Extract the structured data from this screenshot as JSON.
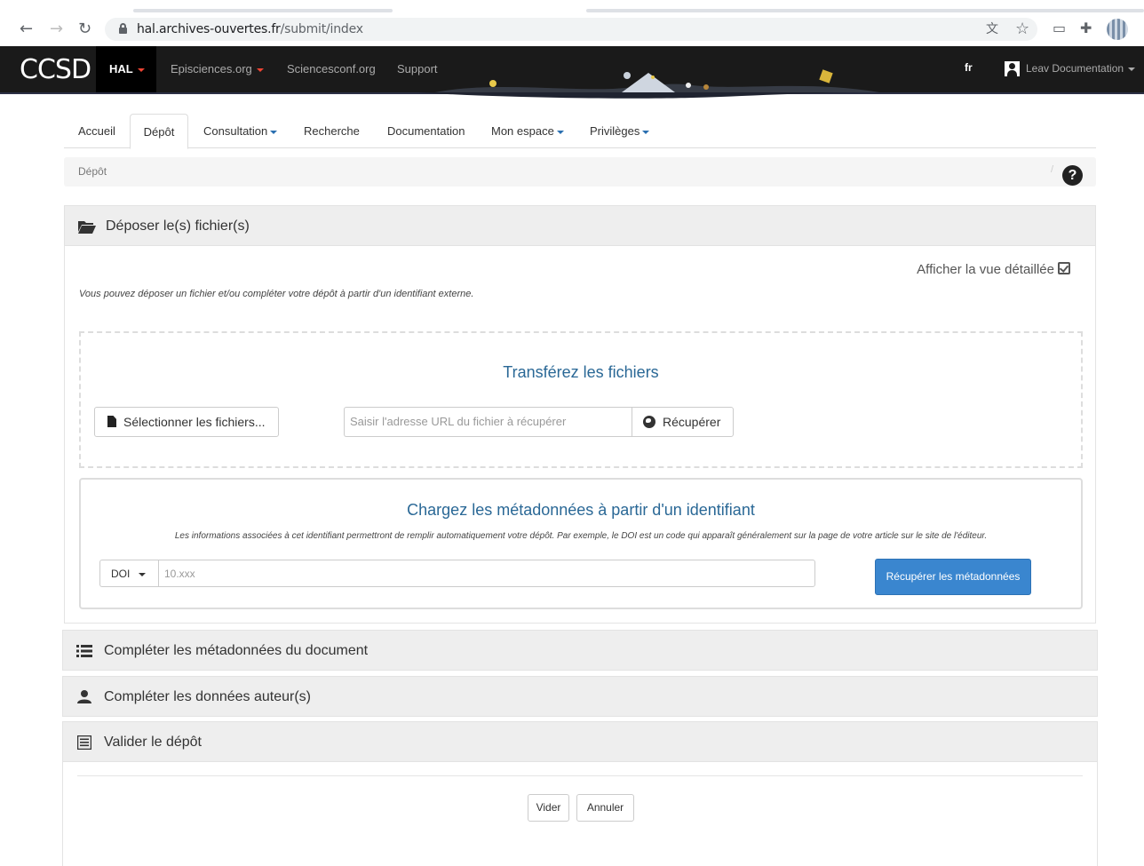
{
  "browser": {
    "url_host": "hal.archives-ouvertes.fr",
    "url_path": "/submit/index"
  },
  "header": {
    "logo": "CCSD",
    "portal": "HAL",
    "links": [
      "Episciences.org",
      "Sciencesconf.org",
      "Support"
    ],
    "lang": "fr",
    "user": "Leav Documentation"
  },
  "nav": {
    "tabs": [
      {
        "label": "Accueil",
        "dropdown": false
      },
      {
        "label": "Dépôt",
        "dropdown": false,
        "active": true
      },
      {
        "label": "Consultation",
        "dropdown": true
      },
      {
        "label": "Recherche",
        "dropdown": false
      },
      {
        "label": "Documentation",
        "dropdown": false
      },
      {
        "label": "Mon espace",
        "dropdown": true
      },
      {
        "label": "Privilèges",
        "dropdown": true
      }
    ]
  },
  "breadcrumb": {
    "current": "Dépôt",
    "separator": "/",
    "help": "?"
  },
  "deposit": {
    "title": "Déposer le(s) fichier(s)",
    "detail_link": "Afficher la vue détaillée",
    "intro": "Vous pouvez déposer un fichier et/ou compléter votre dépôt à partir d'un identifiant externe.",
    "transfer_title": "Transférez les fichiers",
    "select_files": "Sélectionner les fichiers...",
    "url_placeholder": "Saisir l'adresse URL du fichier à récupérer",
    "fetch_label": "Récupérer",
    "meta_title": "Chargez les métadonnées à partir d'un identifiant",
    "meta_desc": "Les informations associées à cet identifiant permettront de remplir automatiquement votre dépôt. Par exemple, le DOI est un code qui apparaît généralement sur la page de votre article sur le site de l'éditeur.",
    "id_type": "DOI",
    "id_placeholder": "10.xxx",
    "fetch_meta_label": "Récupérer les métadonnées"
  },
  "sections": {
    "metadata": "Compléter les métadonnées du document",
    "authors": "Compléter les données auteur(s)",
    "validate": "Valider le dépôt"
  },
  "actions": {
    "clear": "Vider",
    "cancel": "Annuler"
  },
  "colors": {
    "header_bg": "#1a1a1a",
    "accent_blue": "#2a6896",
    "primary_button": "#3a86cf",
    "panel_bg": "#eeeeee"
  }
}
